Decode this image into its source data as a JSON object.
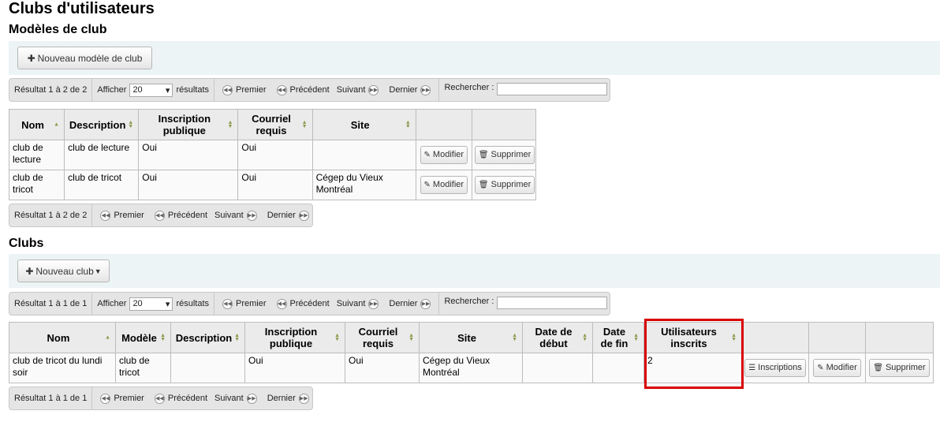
{
  "page_title": "Clubs d'utilisateurs",
  "templates_section": {
    "heading": "Modèles de club",
    "new_button": "Nouveau modèle de club",
    "pager_top": {
      "info": "Résultat 1 à 2 de 2",
      "show_label": "Afficher",
      "show_value": "20",
      "show_suffix": "résultats",
      "first": "Premier",
      "prev": "Précédent",
      "next": "Suivant",
      "last": "Dernier",
      "search_label": "Rechercher :"
    },
    "pager_bottom": {
      "info": "Résultat 1 à 2 de 2",
      "first": "Premier",
      "prev": "Précédent",
      "next": "Suivant",
      "last": "Dernier"
    },
    "columns": [
      "Nom",
      "Description",
      "Inscription publique",
      "Courriel requis",
      "Site"
    ],
    "rows": [
      {
        "name": "club de lecture",
        "description": "club de lecture",
        "public": "Oui",
        "email": "Oui",
        "site": ""
      },
      {
        "name": "club de tricot",
        "description": "club de tricot",
        "public": "Oui",
        "email": "Oui",
        "site": "Cégep du Vieux Montréal"
      }
    ],
    "edit_label": "Modifier",
    "delete_label": "Supprimer"
  },
  "clubs_section": {
    "heading": "Clubs",
    "new_button": "Nouveau club",
    "pager_top": {
      "info": "Résultat 1 à 1 de 1",
      "show_label": "Afficher",
      "show_value": "20",
      "show_suffix": "résultats",
      "first": "Premier",
      "prev": "Précédent",
      "next": "Suivant",
      "last": "Dernier",
      "search_label": "Rechercher :"
    },
    "pager_bottom": {
      "info": "Résultat 1 à 1 de 1",
      "first": "Premier",
      "prev": "Précédent",
      "next": "Suivant",
      "last": "Dernier"
    },
    "columns": [
      "Nom",
      "Modèle",
      "Description",
      "Inscription publique",
      "Courriel requis",
      "Site",
      "Date de début",
      "Date de fin",
      "Utilisateurs inscrits"
    ],
    "rows": [
      {
        "name": "club de tricot du lundi soir",
        "template": "club de tricot",
        "description": "",
        "public": "Oui",
        "email": "Oui",
        "site": "Cégep du Vieux Montréal",
        "start": "",
        "end": "",
        "enrolled": "2"
      }
    ],
    "enrollments_label": "Inscriptions",
    "edit_label": "Modifier",
    "delete_label": "Supprimer"
  },
  "colors": {
    "toolbar_bg": "#edf4f6",
    "highlight": "#d80000",
    "header_bg": "#ebebeb"
  }
}
